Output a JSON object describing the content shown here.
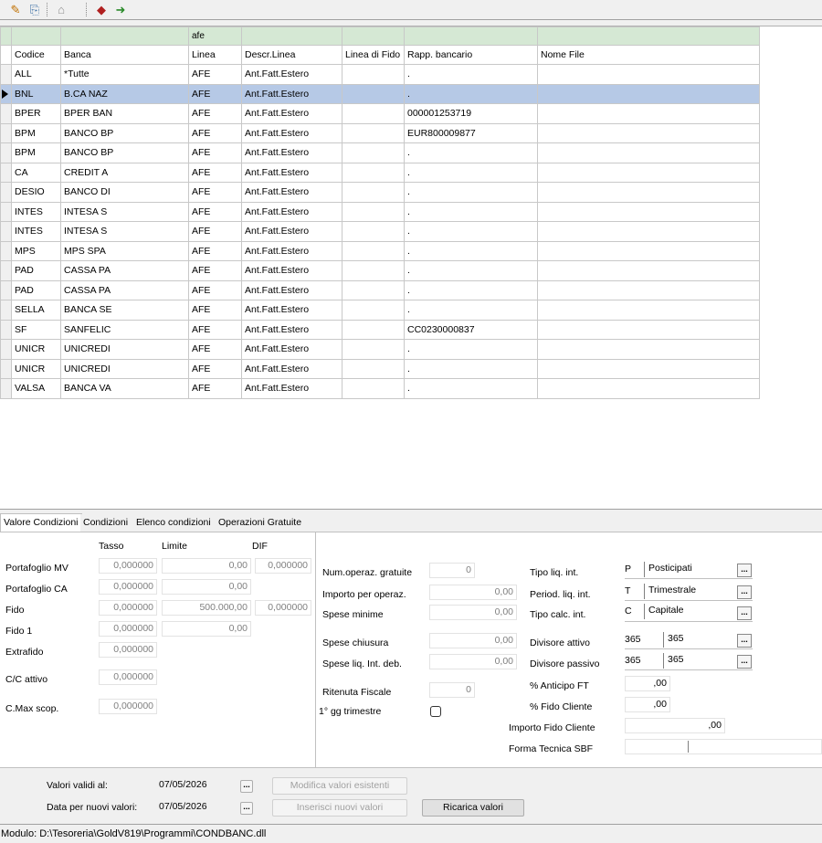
{
  "toolbar": {
    "icons": [
      "pencil-icon",
      "copy-icon",
      "bank-icon",
      "book-icon",
      "exit-icon"
    ]
  },
  "grid": {
    "group_header": "afe",
    "columns": [
      "Codice",
      "Banca",
      "Linea",
      "Descr.Linea",
      "Linea di Fido",
      "Rapp. bancario",
      "Nome File"
    ],
    "rows": [
      [
        "ALL",
        "*Tutte",
        "AFE",
        "Ant.Fatt.Estero",
        "",
        ".",
        ""
      ],
      [
        "BNL",
        "B.CA NAZ",
        "AFE",
        "Ant.Fatt.Estero",
        "",
        ".",
        ""
      ],
      [
        "BPER",
        "BPER BAN",
        "AFE",
        "Ant.Fatt.Estero",
        "",
        "000001253719",
        ""
      ],
      [
        "BPM",
        "BANCO BP",
        "AFE",
        "Ant.Fatt.Estero",
        "",
        "EUR800009877",
        ""
      ],
      [
        "BPM",
        "BANCO BP",
        "AFE",
        "Ant.Fatt.Estero",
        "",
        ".",
        ""
      ],
      [
        "CA",
        "CREDIT A",
        "AFE",
        "Ant.Fatt.Estero",
        "",
        ".",
        ""
      ],
      [
        "DESIO",
        "BANCO DI",
        "AFE",
        "Ant.Fatt.Estero",
        "",
        ".",
        ""
      ],
      [
        "INTES",
        "INTESA S",
        "AFE",
        "Ant.Fatt.Estero",
        "",
        ".",
        ""
      ],
      [
        "INTES",
        "INTESA S",
        "AFE",
        "Ant.Fatt.Estero",
        "",
        ".",
        ""
      ],
      [
        "MPS",
        "MPS SPA",
        "AFE",
        "Ant.Fatt.Estero",
        "",
        ".",
        ""
      ],
      [
        "PAD",
        "CASSA PA",
        "AFE",
        "Ant.Fatt.Estero",
        "",
        ".",
        ""
      ],
      [
        "PAD",
        "CASSA PA",
        "AFE",
        "Ant.Fatt.Estero",
        "",
        ".",
        ""
      ],
      [
        "SELLA",
        "BANCA SE",
        "AFE",
        "Ant.Fatt.Estero",
        "",
        ".",
        ""
      ],
      [
        "SF",
        "SANFELIC",
        "AFE",
        "Ant.Fatt.Estero",
        "",
        "CC0230000837",
        ""
      ],
      [
        "UNICR",
        "UNICREDI",
        "AFE",
        "Ant.Fatt.Estero",
        "",
        ".",
        ""
      ],
      [
        "UNICR",
        "UNICREDI",
        "AFE",
        "Ant.Fatt.Estero",
        "",
        ".",
        ""
      ],
      [
        "VALSA",
        "BANCA VA",
        "AFE",
        "Ant.Fatt.Estero",
        "",
        ".",
        ""
      ]
    ],
    "selected_row_index": 1
  },
  "tabs": [
    "Valore Condizioni",
    "Condizioni",
    "Elenco condizioni",
    "Operazioni Gratuite"
  ],
  "left": {
    "headers": {
      "tasso": "Tasso",
      "limite": "Limite",
      "dif": "DIF"
    },
    "rows": [
      {
        "label": "Portafoglio MV",
        "tasso": "0,000000",
        "limite": "0,00",
        "dif": "0,000000"
      },
      {
        "label": "Portafoglio CA",
        "tasso": "0,000000",
        "limite": "0,00",
        "dif": ""
      },
      {
        "label": "Fido",
        "tasso": "0,000000",
        "limite": "500.000,00",
        "dif": "0,000000"
      },
      {
        "label": "Fido 1",
        "tasso": "0,000000",
        "limite": "0,00",
        "dif": ""
      },
      {
        "label": "Extrafido",
        "tasso": "0,000000",
        "limite": "",
        "dif": ""
      },
      {
        "label": "C/C attivo",
        "tasso": "0,000000",
        "limite": "",
        "dif": ""
      },
      {
        "label": "C.Max scop.",
        "tasso": "0,000000",
        "limite": "",
        "dif": ""
      }
    ]
  },
  "middle": {
    "num_operaz_label": "Num.operaz. gratuite",
    "num_operaz": "0",
    "importo_label": "Importo per operaz.",
    "importo": "0,00",
    "spese_min_label": "Spese minime",
    "spese_min": "0,00",
    "spese_chiusura_label": "Spese chiusura",
    "spese_chiusura": "0,00",
    "spese_liq_label": "Spese liq. Int. deb.",
    "spese_liq": "0,00",
    "ritenuta_label": "Ritenuta Fiscale",
    "ritenuta": "0",
    "gg_label": "1° gg trimestre"
  },
  "right": {
    "tipo_liq_label": "Tipo liq. int.",
    "tipo_liq_code": "P",
    "tipo_liq_desc": "Posticipati",
    "period_label": "Period. liq. int.",
    "period_code": "T",
    "period_desc": "Trimestrale",
    "tipo_calc_label": "Tipo calc. int.",
    "tipo_calc_code": "C",
    "tipo_calc_desc": "Capitale",
    "div_att_label": "Divisore attivo",
    "div_att_code": "365",
    "div_att_desc": "365",
    "div_pass_label": "Divisore passivo",
    "div_pass_code": "365",
    "div_pass_desc": "365",
    "anticipo_label": "% Anticipo FT",
    "anticipo": ",00",
    "fido_cliente_label": "% Fido Cliente",
    "fido_cliente": ",00",
    "importo_fido_label": "Importo Fido Cliente",
    "importo_fido": ",00",
    "forma_label": "Forma Tecnica SBF"
  },
  "bottom": {
    "valori_validi_label": "Valori validi al:",
    "valori_validi": "07/05/2026",
    "data_nuovi_label": "Data per nuovi valori:",
    "data_nuovi": "07/05/2026",
    "ellipsis": "...",
    "modifica_label": "Modifica valori esistenti",
    "inserisci_label": "Inserisci nuovi valori",
    "ricarica_label": "Ricarica valori"
  },
  "status": {
    "text": "Modulo: D:\\Tesoreria\\GoldV819\\Programmi\\CONDBANC.dll"
  }
}
